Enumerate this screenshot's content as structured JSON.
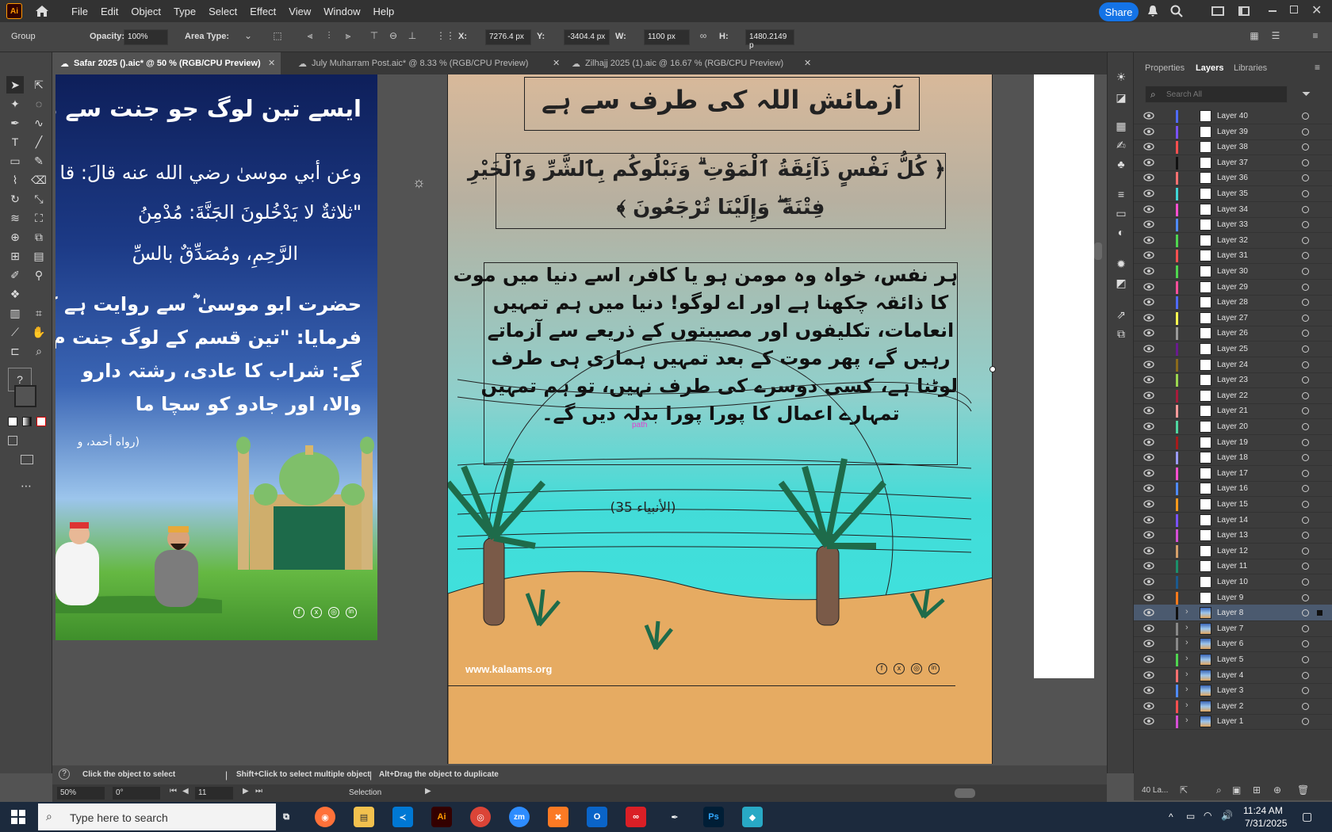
{
  "app": {
    "logo": "Ai"
  },
  "menu": [
    "File",
    "Edit",
    "Object",
    "Type",
    "Select",
    "Effect",
    "View",
    "Window",
    "Help"
  ],
  "share_label": "Share",
  "control": {
    "selection_kind": "Group",
    "opacity_label": "Opacity:",
    "opacity_value": "100%",
    "area_type_label": "Area Type:",
    "x_label": "X:",
    "x_value": "7276.4 px",
    "y_label": "Y:",
    "y_value": "-3404.4 px",
    "w_label": "W:",
    "w_value": "1100 px",
    "h_label": "H:",
    "h_value": "1480.2149 p"
  },
  "tabs": [
    {
      "label": "Safar 2025 ().aic* @ 50 % (RGB/CPU Preview)",
      "active": true
    },
    {
      "label": "July Muharram Post.aic* @ 8.33 % (RGB/CPU Preview)",
      "active": false
    },
    {
      "label": "Zilhajj 2025 (1).aic @ 16.67 % (RGB/CPU Preview)",
      "active": false
    }
  ],
  "left_artboard": {
    "title": "ایسے تین لوگ جو جنت سے م",
    "arabic1": "وعن أبي موسىٰ رضي الله عنه قالَ: قا",
    "arabic2": "\"ثلاثةٌ لا يَدْخُلونَ الجَنَّةَ: مُدْمِنُ",
    "arabic3": "الرَّحِمِ، ومُصَدِّقٌ بالسِّ",
    "urdu1": "حضرت ابو موسیٰ ؓ سے روایت ہے کہ",
    "urdu2": "فرمایا: \"تین قسم کے لوگ جنت م",
    "urdu3": "گے: شراب کا عادی، رشتہ دارو",
    "urdu4": "والا، اور جادو کو سچا ما",
    "citation": "(رواه أحمد، و"
  },
  "main_artboard": {
    "heading": "آزمائش اللہ کی طرف سے ہے",
    "ayah1": "﴿ كُلُّ نَفْسٍ ذَآئِقَةُ ٱلْمَوْتِ ۗ وَنَبْلُوكُم بِٱلشَّرِّ وَٱلْخَيْرِ",
    "ayah2": "فِتْنَةً ۖ وَإِلَيْنَا تُرْجَعُونَ ﴾",
    "body": [
      "ہر نفس، خواہ وہ مومن ہو یا کافر، اسے دنیا میں موت",
      "کا ذائقہ چکھنا ہے اور اے لوگو! دنیا میں ہم تمہیں",
      "انعامات، تکلیفوں اور مصیبتوں کے ذریعے سے آزماتے",
      "رہیں گے، پھر موت کے بعد تمہیں ہماری ہی طرف",
      "لوٹنا ہے، کسی دوسرے کی طرف نہیں، تو ہم تمہیں",
      "تمہارے اعمال کا پورا پورا بدلہ دیں گے۔"
    ],
    "reference": "(الأنبياء 35)",
    "path_label": "path",
    "website": "www.kalaams.org"
  },
  "panel": {
    "tabs": [
      "Properties",
      "Layers",
      "Libraries"
    ],
    "active_tab": "Layers",
    "search_placeholder": "Search All",
    "layer_count": "40 La...",
    "layers": [
      {
        "name": "Layer 40",
        "color": "#4f6bff",
        "expand": false
      },
      {
        "name": "Layer 39",
        "color": "#7a52ff",
        "expand": false
      },
      {
        "name": "Layer 38",
        "color": "#ff4f4f",
        "expand": false
      },
      {
        "name": "Layer 37",
        "color": "#111111",
        "expand": false
      },
      {
        "name": "Layer 36",
        "color": "#ff7070",
        "expand": false
      },
      {
        "name": "Layer 35",
        "color": "#3fd6d6",
        "expand": false
      },
      {
        "name": "Layer 34",
        "color": "#ff4fd0",
        "expand": false
      },
      {
        "name": "Layer 33",
        "color": "#4f8bff",
        "expand": false
      },
      {
        "name": "Layer 32",
        "color": "#4fd64f",
        "expand": false
      },
      {
        "name": "Layer 31",
        "color": "#ff5050",
        "expand": false
      },
      {
        "name": "Layer 30",
        "color": "#4fd64f",
        "expand": false
      },
      {
        "name": "Layer 29",
        "color": "#ff4f9a",
        "expand": false
      },
      {
        "name": "Layer 28",
        "color": "#4f6bff",
        "expand": false
      },
      {
        "name": "Layer 27",
        "color": "#ffff4f",
        "expand": false
      },
      {
        "name": "Layer 26",
        "color": "#999999",
        "expand": false
      },
      {
        "name": "Layer 25",
        "color": "#6a1b8f",
        "expand": false
      },
      {
        "name": "Layer 24",
        "color": "#8a6a1b",
        "expand": false
      },
      {
        "name": "Layer 23",
        "color": "#9ad64f",
        "expand": false
      },
      {
        "name": "Layer 22",
        "color": "#a81b3a",
        "expand": false
      },
      {
        "name": "Layer 21",
        "color": "#ff9a9a",
        "expand": false
      },
      {
        "name": "Layer 20",
        "color": "#4fd6a0",
        "expand": false
      },
      {
        "name": "Layer 19",
        "color": "#a81b1b",
        "expand": false
      },
      {
        "name": "Layer 18",
        "color": "#9a9aff",
        "expand": false
      },
      {
        "name": "Layer 17",
        "color": "#ff4fd0",
        "expand": false
      },
      {
        "name": "Layer 16",
        "color": "#4f8bff",
        "expand": false
      },
      {
        "name": "Layer 15",
        "color": "#ff9a1b",
        "expand": false
      },
      {
        "name": "Layer 14",
        "color": "#7a52ff",
        "expand": false
      },
      {
        "name": "Layer 13",
        "color": "#d64fd6",
        "expand": false
      },
      {
        "name": "Layer 12",
        "color": "#d6a06a",
        "expand": false
      },
      {
        "name": "Layer 11",
        "color": "#1b8f6a",
        "expand": false
      },
      {
        "name": "Layer 10",
        "color": "#1b5a8f",
        "expand": false
      },
      {
        "name": "Layer 9",
        "color": "#ff7a1b",
        "expand": false
      },
      {
        "name": "Layer 8",
        "color": "#111111",
        "expand": true
      },
      {
        "name": "Layer 7",
        "color": "#888888",
        "expand": true
      },
      {
        "name": "Layer 6",
        "color": "#888888",
        "expand": true
      },
      {
        "name": "Layer 5",
        "color": "#4fd64f",
        "expand": true
      },
      {
        "name": "Layer 4",
        "color": "#ff7070",
        "expand": true
      },
      {
        "name": "Layer 3",
        "color": "#4f8bff",
        "expand": true
      },
      {
        "name": "Layer 2",
        "color": "#ff4f4f",
        "expand": true
      },
      {
        "name": "Layer 1",
        "color": "#d64fd6",
        "expand": true
      }
    ],
    "selected_layer": "Layer 8"
  },
  "status": {
    "hint_1": "Click the object to select",
    "hint_2": "Shift+Click to select multiple object",
    "hint_3": "Alt+Drag the object to duplicate",
    "zoom": "50%",
    "rotation": "0°",
    "artboard_num": "11",
    "tool_name": "Selection"
  },
  "taskbar": {
    "search_placeholder": "Type here to search",
    "time": "11:24 AM",
    "date": "7/31/2025"
  }
}
